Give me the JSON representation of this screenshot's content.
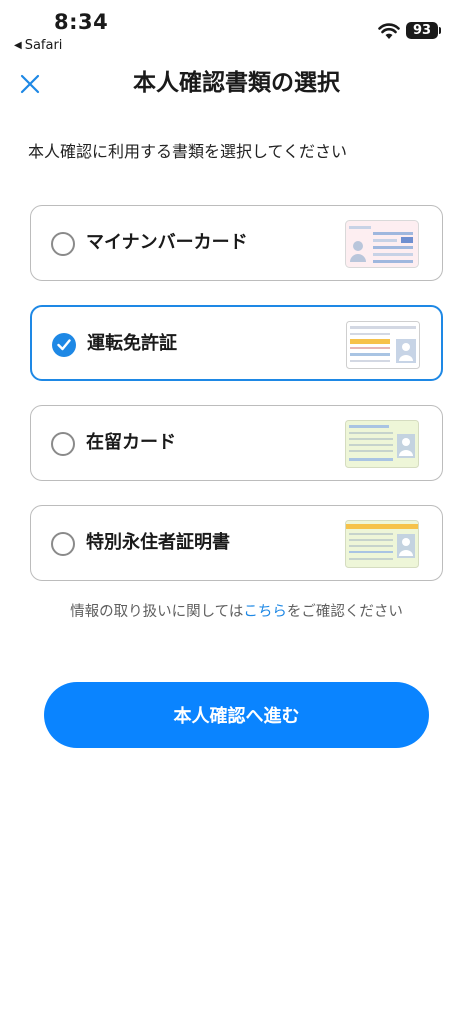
{
  "status_bar": {
    "time": "8:34",
    "back_app_label": "Safari",
    "battery_level": "93"
  },
  "header": {
    "title": "本人確認書類の選択",
    "close_icon": "close-icon"
  },
  "instruction": "本人確認に利用する書類を選択してください",
  "options": [
    {
      "label": "マイナンバーカード",
      "selected": false,
      "icon": "my-number-card-icon"
    },
    {
      "label": "運転免許証",
      "selected": true,
      "icon": "drivers-license-icon"
    },
    {
      "label": "在留カード",
      "selected": false,
      "icon": "residence-card-icon"
    },
    {
      "label": "特別永住者証明書",
      "selected": false,
      "icon": "special-permanent-resident-certificate-icon"
    }
  ],
  "notice": {
    "before": "情報の取り扱いに関しては",
    "link": "こちら",
    "after": "をご確認ください"
  },
  "cta": {
    "label": "本人確認へ進む"
  },
  "colors": {
    "accent": "#1e88e5",
    "cta_background": "#0a84ff",
    "card_border": "#bcbcbc"
  }
}
